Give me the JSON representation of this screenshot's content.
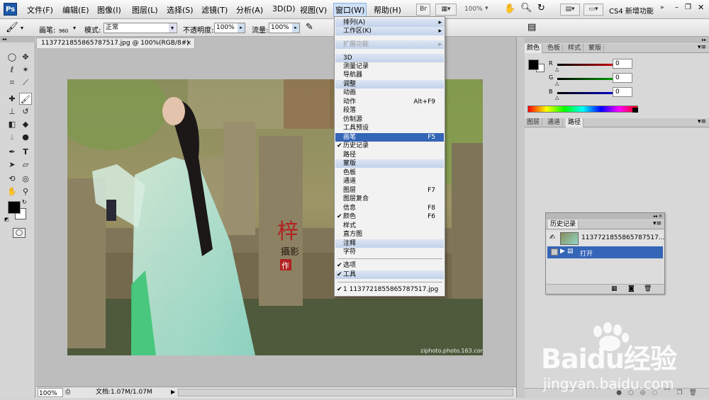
{
  "app": {
    "logo": "Ps"
  },
  "menubar": {
    "items": [
      "文件(F)",
      "编辑(E)",
      "图像(I)",
      "图层(L)",
      "选择(S)",
      "滤镜(T)",
      "分析(A)",
      "3D(D)",
      "视图(V)",
      "窗口(W)",
      "帮助(H)"
    ],
    "bridge_label": "Br",
    "zoom_value": "100%",
    "workspace_label": "CS4 新增功能"
  },
  "options": {
    "brush_label": "画笔:",
    "brush_size": "960",
    "mode_label": "模式:",
    "mode_value": "正常",
    "opacity_label": "不透明度:",
    "opacity_value": "100%",
    "flow_label": "流量:",
    "flow_value": "100%"
  },
  "document": {
    "tab_title": "1137721855865787517.jpg @ 100%(RGB/8#)",
    "photo_credit": "ziphoto.photo.163.com",
    "seal_char": "梓",
    "seal_sub": "攝影",
    "seal_box": "作"
  },
  "status": {
    "zoom": "100%",
    "doc_info": "文档:1.07M/1.07M"
  },
  "window_menu": {
    "items": [
      {
        "label": "排列(A)",
        "submenu": true,
        "type": "section"
      },
      {
        "label": "工作区(K)",
        "submenu": true,
        "type": "section"
      },
      {
        "label": "",
        "type": "sep"
      },
      {
        "label": "扩展功能",
        "submenu": true,
        "type": "section-disabled"
      },
      {
        "label": "",
        "type": "sep"
      },
      {
        "label": "3D",
        "type": "section"
      },
      {
        "label": "测量记录",
        "type": "item"
      },
      {
        "label": "导航器",
        "type": "item"
      },
      {
        "label": "调整",
        "type": "section"
      },
      {
        "label": "动画",
        "type": "item"
      },
      {
        "label": "动作",
        "shortcut": "Alt+F9",
        "type": "item"
      },
      {
        "label": "段落",
        "type": "item"
      },
      {
        "label": "仿制源",
        "type": "item"
      },
      {
        "label": "工具预设",
        "type": "item"
      },
      {
        "label": "画笔",
        "shortcut": "F5",
        "type": "highlight"
      },
      {
        "label": "历史记录",
        "checked": true,
        "type": "item"
      },
      {
        "label": "路径",
        "type": "item"
      },
      {
        "label": "蒙版",
        "type": "section"
      },
      {
        "label": "色板",
        "type": "item"
      },
      {
        "label": "通道",
        "type": "item"
      },
      {
        "label": "图层",
        "shortcut": "F7",
        "type": "item"
      },
      {
        "label": "图层复合",
        "type": "item"
      },
      {
        "label": "信息",
        "shortcut": "F8",
        "type": "item"
      },
      {
        "label": "颜色",
        "shortcut": "F6",
        "checked": true,
        "type": "item"
      },
      {
        "label": "样式",
        "type": "item"
      },
      {
        "label": "直方图",
        "type": "item"
      },
      {
        "label": "注释",
        "type": "section"
      },
      {
        "label": "字符",
        "type": "item"
      },
      {
        "label": "",
        "type": "sep"
      },
      {
        "label": "选项",
        "checked": true,
        "type": "item"
      },
      {
        "label": "工具",
        "checked": true,
        "type": "section"
      },
      {
        "label": "",
        "type": "sep"
      },
      {
        "label": "1 1137721855865787517.jpg",
        "checked": true,
        "type": "item"
      }
    ]
  },
  "color_panel": {
    "tabs": [
      "颜色",
      "色板",
      "样式",
      "蒙版"
    ],
    "channels": [
      {
        "name": "R",
        "value": "0",
        "color": "#cc0000"
      },
      {
        "name": "G",
        "value": "0",
        "color": "#00a000"
      },
      {
        "name": "B",
        "value": "0",
        "color": "#0000cc"
      }
    ]
  },
  "layers_panel": {
    "tabs": [
      "图层",
      "通道",
      "路径"
    ]
  },
  "history_panel": {
    "title": "历史记录",
    "snapshot": "1137721855865787517...",
    "state": "打开"
  },
  "watermark": {
    "brand": "Baidu经验",
    "url": "jingyan.baidu.com"
  }
}
